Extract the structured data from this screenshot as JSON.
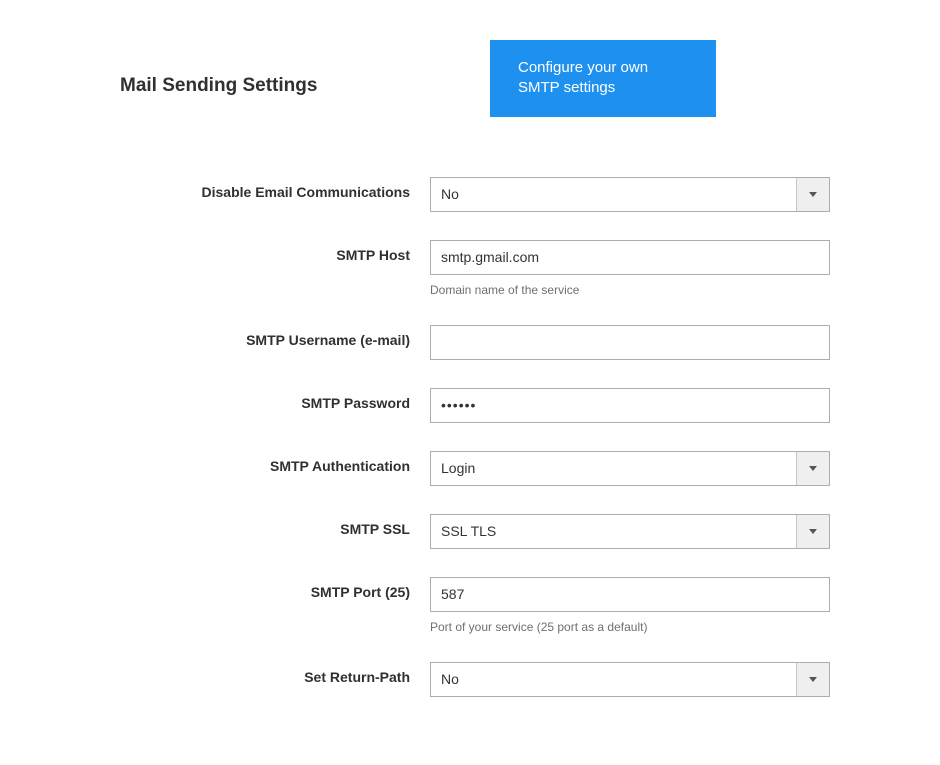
{
  "section": {
    "title": "Mail Sending Settings",
    "cta_label": "Configure your own SMTP settings"
  },
  "fields": {
    "disable_email": {
      "label": "Disable Email Communications",
      "value": "No"
    },
    "smtp_host": {
      "label": "SMTP Host",
      "value": "smtp.gmail.com",
      "help": "Domain name of the service"
    },
    "smtp_username": {
      "label": "SMTP Username (e-mail)",
      "value": ""
    },
    "smtp_password": {
      "label": "SMTP Password",
      "value": "••••••"
    },
    "smtp_auth": {
      "label": "SMTP Authentication",
      "value": "Login"
    },
    "smtp_ssl": {
      "label": "SMTP SSL",
      "value": "SSL TLS"
    },
    "smtp_port": {
      "label": "SMTP Port (25)",
      "value": "587",
      "help": "Port of your service (25 port as a default)"
    },
    "return_path": {
      "label": "Set Return-Path",
      "value": "No"
    }
  }
}
